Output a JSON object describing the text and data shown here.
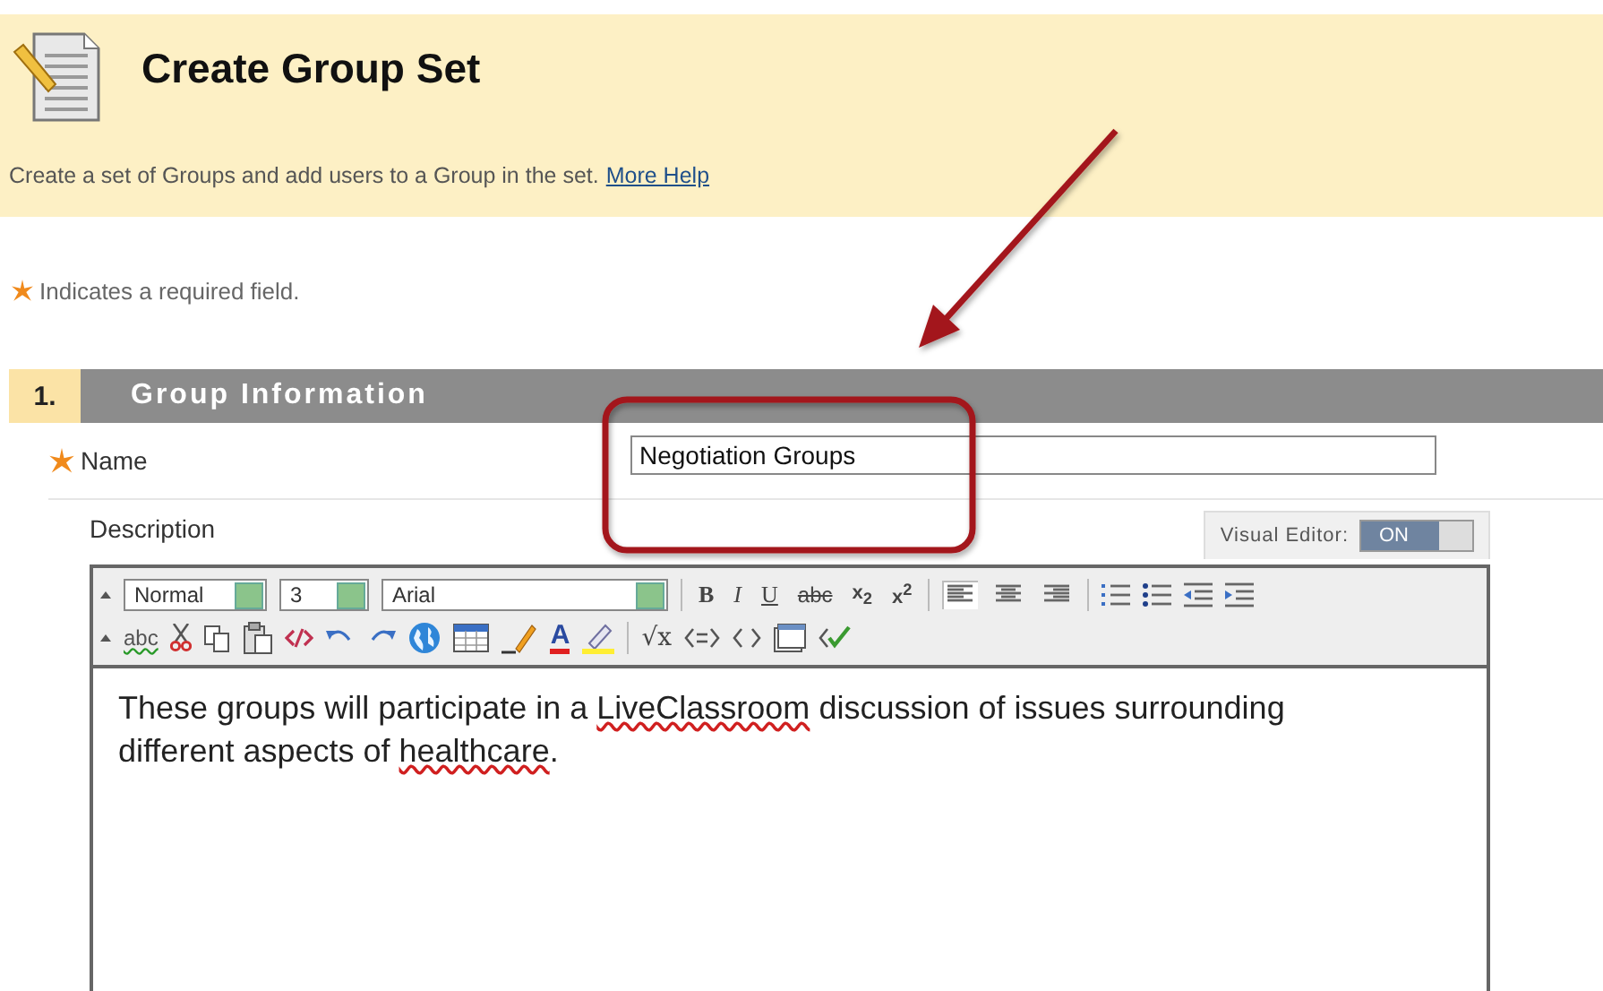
{
  "header": {
    "title": "Create Group Set",
    "description": "Create a set of Groups and add users to a Group in the set.",
    "help_link": "More Help"
  },
  "required_note": "Indicates a required field.",
  "section": {
    "number": "1.",
    "title": "Group Information"
  },
  "name_field": {
    "label": "Name",
    "required": true,
    "value": "Negotiation Groups"
  },
  "description_field": {
    "label": "Description",
    "visual_editor": {
      "label": "Visual Editor:",
      "toggle": "ON",
      "on": true
    },
    "toolbar": {
      "font_style": "Normal",
      "font_size": "3",
      "font_family": "Arial",
      "format_buttons": [
        "B",
        "I",
        "U",
        "abc",
        "x$_{2}$",
        "x$^{2}$"
      ],
      "alignment": [
        {
          "selected": true
        },
        {
          "selected": false
        },
        {
          "selected": false
        }
      ],
      "spellcheck": "abc",
      "font_color": "A",
      "math": "√x"
    },
    "text": [
      {
        "text": "These groups will participate in a ",
        "misspelled": false
      },
      {
        "text": "LiveClassroom",
        "misspelled": true
      },
      {
        "text": " discussion of issues surrounding different aspects of ",
        "misspelled": false
      },
      {
        "text": "healthcare",
        "misspelled": true
      },
      {
        "text": ".",
        "misspelled": false
      }
    ]
  }
}
